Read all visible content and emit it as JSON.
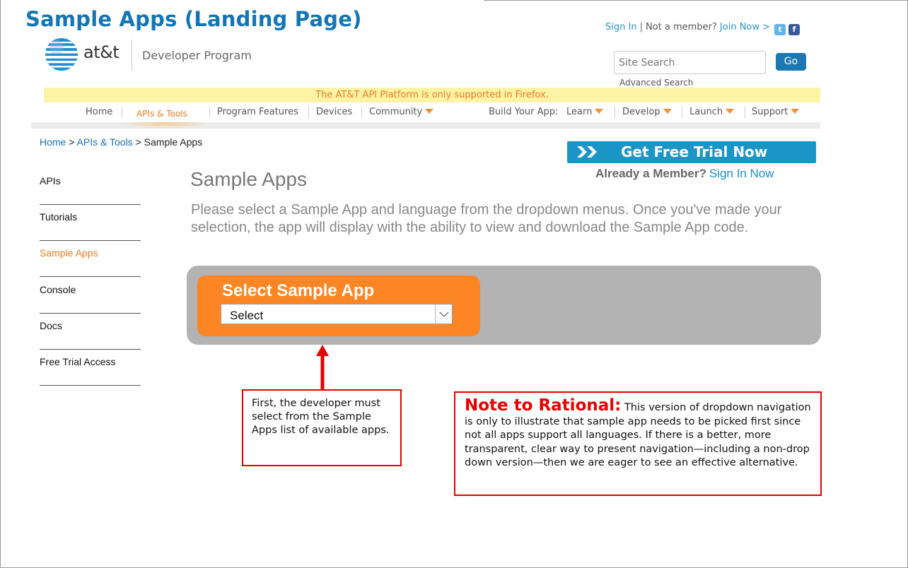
{
  "page_title": "Sample Apps (Landing Page)",
  "header": {
    "logo_word": "at&t",
    "program": "Developer Program",
    "sign_in": "Sign In",
    "not_member": "Not a member?",
    "join_now": "Join Now >",
    "search_placeholder": "Site Search",
    "go_label": "Go",
    "advanced_search": "Advanced Search",
    "banner": "The AT&T API Platform is only supported in Firefox."
  },
  "nav": {
    "home": "Home",
    "apis_tools": "APIs & Tools",
    "program_features": "Program Features",
    "devices": "Devices",
    "community": "Community",
    "build_your_app": "Build Your App:",
    "learn": "Learn",
    "develop": "Develop",
    "launch": "Launch",
    "support": "Support"
  },
  "breadcrumb": {
    "home": "Home",
    "apis_tools": "APIs & Tools",
    "current": "Sample Apps"
  },
  "trial": {
    "button_label": "Get Free Trial Now",
    "already_member": "Already a Member?",
    "sign_in_now": "Sign In Now"
  },
  "sidebar": {
    "items": [
      {
        "label": "APIs"
      },
      {
        "label": "Tutorials"
      },
      {
        "label": "Sample Apps"
      },
      {
        "label": "Console"
      },
      {
        "label": "Docs"
      },
      {
        "label": "Free Trial Access"
      }
    ]
  },
  "main": {
    "heading": "Sample Apps",
    "description": "Please select a Sample App and language from the dropdown menus. Once you've made your selection, the app will display with the ability to view and download the Sample App code.",
    "selector_title": "Select Sample App",
    "select_value": "Select"
  },
  "callouts": {
    "first": "First, the developer must select from the Sample Apps list of available apps.",
    "note_heading": "Note to Rational:",
    "note_body": "This version of dropdown navigation is only to illustrate that sample app needs to be picked first since not all apps support all languages. If there is a better, more transparent, clear way to present navigation—including a non-drop down version—then we are eager to see an effective alternative."
  },
  "colors": {
    "accent_blue": "#1375b4",
    "orange": "#fd8524",
    "callout_red": "#e60000"
  }
}
